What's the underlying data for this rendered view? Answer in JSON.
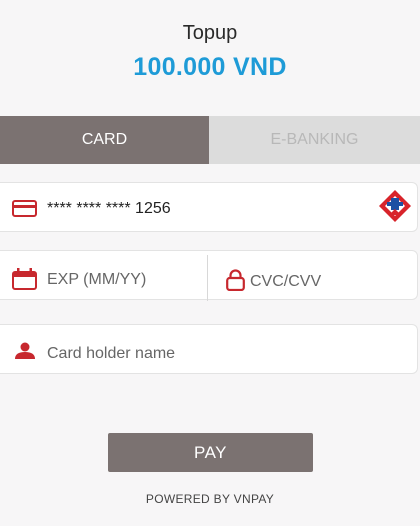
{
  "header": {
    "title": "Topup",
    "amount": "100.000 VND"
  },
  "tabs": [
    {
      "label": "CARD",
      "active": true
    },
    {
      "label": "E-BANKING",
      "active": false
    }
  ],
  "card_field": {
    "value": "**** **** **** 1256",
    "icon": "credit-card-icon",
    "bank_logo": "bank-logo"
  },
  "exp_field": {
    "placeholder": "EXP (MM/YY)",
    "icon": "calendar-icon"
  },
  "cvc_field": {
    "placeholder": "CVC/CVV",
    "icon": "lock-icon"
  },
  "name_field": {
    "placeholder": "Card holder name",
    "icon": "user-icon"
  },
  "pay_button": {
    "label": "PAY"
  },
  "footer": {
    "powered_by": "POWERED BY VNPAY"
  },
  "colors": {
    "accent": "#1e9bd7",
    "icon_red": "#c7282e",
    "active_tab": "#7b7271",
    "inactive_tab": "#dcdcdc",
    "pay_button": "#7b7271"
  }
}
